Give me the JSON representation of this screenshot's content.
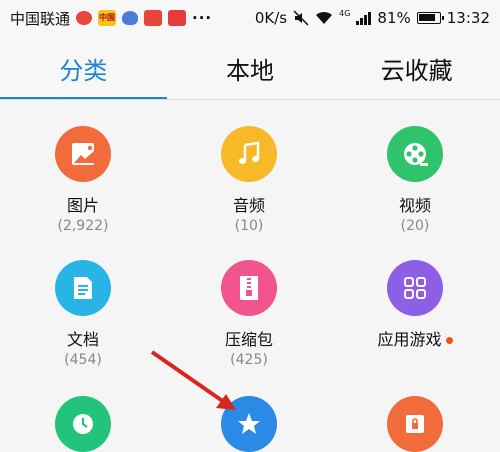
{
  "status_bar": {
    "carrier": "中国联通",
    "speed": "0K/s",
    "network": "4G",
    "battery": "81%",
    "time": "13:32",
    "more": "···"
  },
  "tabs": [
    {
      "label": "分类",
      "active": true
    },
    {
      "label": "本地",
      "active": false
    },
    {
      "label": "云收藏",
      "active": false
    }
  ],
  "categories": [
    {
      "label": "图片",
      "count": "(2,922)",
      "icon": "image-icon",
      "color": "#f26b3a"
    },
    {
      "label": "音频",
      "count": "(10)",
      "icon": "music-icon",
      "color": "#f7b928"
    },
    {
      "label": "视频",
      "count": "(20)",
      "icon": "video-icon",
      "color": "#2fc36b"
    },
    {
      "label": "文档",
      "count": "(454)",
      "icon": "document-icon",
      "color": "#29b4e6"
    },
    {
      "label": "压缩包",
      "count": "(425)",
      "icon": "archive-icon",
      "color": "#f2548d"
    },
    {
      "label": "应用游戏",
      "count": "",
      "icon": "apps-icon",
      "color": "#8d5ee6"
    },
    {
      "label": "",
      "count": "",
      "icon": "clock-icon",
      "color": "#22c47c"
    },
    {
      "label": "",
      "count": "",
      "icon": "star-icon",
      "color": "#2a8ae6"
    },
    {
      "label": "",
      "count": "",
      "icon": "safe-icon",
      "color": "#f26b3a"
    }
  ]
}
